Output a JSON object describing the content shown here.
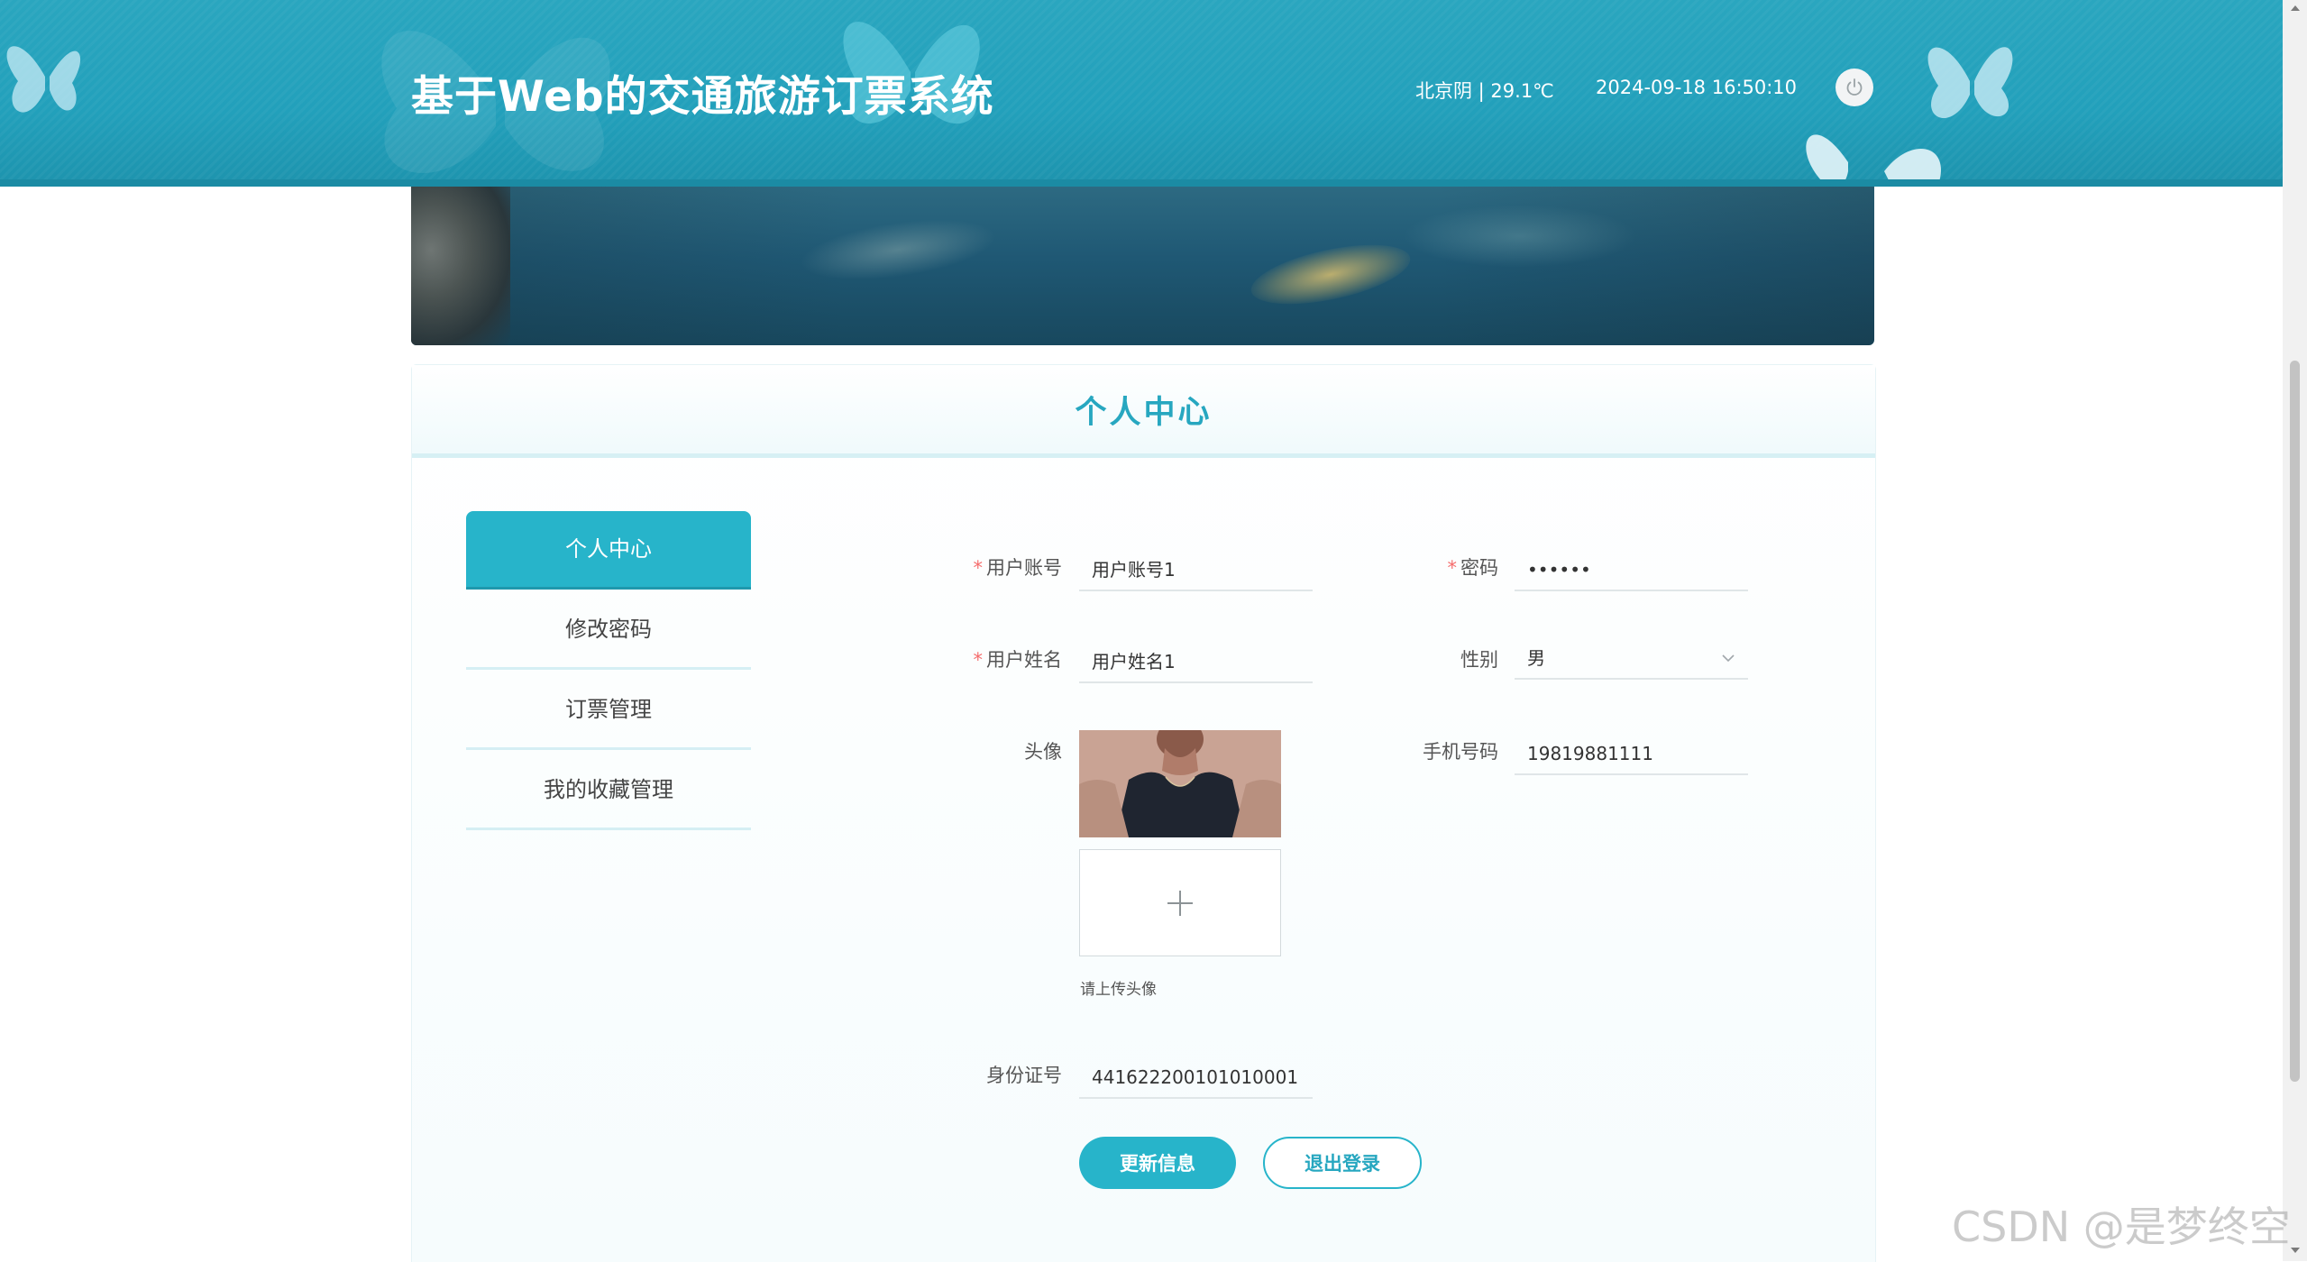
{
  "header": {
    "title": "基于Web的交通旅游订票系统",
    "weather": "北京阴 | 29.1℃",
    "datetime": "2024-09-18   16:50:10",
    "power_icon": "power-icon"
  },
  "panel": {
    "title": "个人中心"
  },
  "menu": {
    "items": [
      {
        "label": "个人中心",
        "active": true
      },
      {
        "label": "修改密码",
        "active": false
      },
      {
        "label": "订票管理",
        "active": false
      },
      {
        "label": "我的收藏管理",
        "active": false
      }
    ]
  },
  "form": {
    "account": {
      "label": "用户账号",
      "value": "用户账号1",
      "required": true
    },
    "password": {
      "label": "密码",
      "value": "••••••",
      "required": true
    },
    "name": {
      "label": "用户姓名",
      "value": "用户姓名1",
      "required": true
    },
    "gender": {
      "label": "性别",
      "value": "男"
    },
    "avatar": {
      "label": "头像",
      "upload_hint": "请上传头像"
    },
    "phone": {
      "label": "手机号码",
      "value": "19819881111"
    },
    "id_card": {
      "label": "身份证号",
      "value": "441622200101010001"
    }
  },
  "buttons": {
    "update": "更新信息",
    "logout": "退出登录"
  },
  "watermark": "CSDN @是梦终空",
  "colors": {
    "primary": "#27b4ca",
    "header": "#22a0bb",
    "required": "#f56c6c"
  }
}
